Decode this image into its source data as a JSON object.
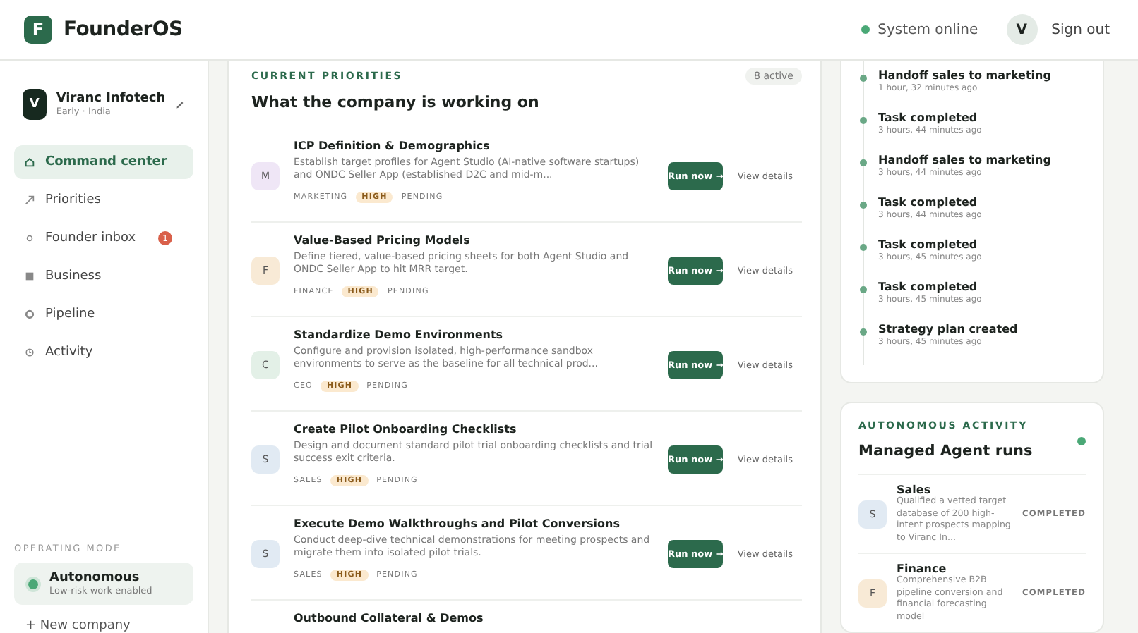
{
  "header": {
    "logo_letter": "F",
    "app_name": "FounderOS",
    "status": "System online",
    "avatar_letter": "V",
    "sign_out": "Sign out"
  },
  "sidebar": {
    "company": {
      "letter": "V",
      "name": "Viranc Infotech",
      "meta": "Early · India"
    },
    "items": [
      {
        "label": "Command center",
        "selected": true
      },
      {
        "label": "Priorities",
        "selected": false
      },
      {
        "label": "Founder inbox",
        "selected": false,
        "badge": "1"
      },
      {
        "label": "Business",
        "selected": false
      },
      {
        "label": "Pipeline",
        "selected": false
      },
      {
        "label": "Activity",
        "selected": false
      }
    ],
    "mode_heading": "OPERATING MODE",
    "mode": {
      "title": "Autonomous",
      "subtitle": "Low-risk work enabled"
    },
    "new_company": "+ New company"
  },
  "priorities": {
    "eyebrow": "CURRENT PRIORITIES",
    "title": "What the company is working on",
    "count": "8 active",
    "items": [
      {
        "letter": "M",
        "color": "#efe6f6",
        "title": "ICP Definition & Demographics",
        "description": "Establish target profiles for Agent Studio (AI-native software startups) and ONDC Seller App (established D2C and mid-m...",
        "team": "MARKETING",
        "priority": "HIGH",
        "status": "PENDING",
        "run": "Run now →",
        "details": "View details"
      },
      {
        "letter": "F",
        "color": "#f8ead6",
        "title": "Value-Based Pricing Models",
        "description": "Define tiered, value-based pricing sheets for both Agent Studio and ONDC Seller App to hit MRR target.",
        "team": "FINANCE",
        "priority": "HIGH",
        "status": "PENDING",
        "run": "Run now →",
        "details": "View details"
      },
      {
        "letter": "C",
        "color": "#e3f0e7",
        "title": "Standardize Demo Environments",
        "description": "Configure and provision isolated, high-performance sandbox environments to serve as the baseline for all technical prod...",
        "team": "CEO",
        "priority": "HIGH",
        "status": "PENDING",
        "run": "Run now →",
        "details": "View details"
      },
      {
        "letter": "S",
        "color": "#e1eaf3",
        "title": "Create Pilot Onboarding Checklists",
        "description": "Design and document standard pilot trial onboarding checklists and trial success exit criteria.",
        "team": "SALES",
        "priority": "HIGH",
        "status": "PENDING",
        "run": "Run now →",
        "details": "View details"
      },
      {
        "letter": "S",
        "color": "#e1eaf3",
        "title": "Execute Demo Walkthroughs and Pilot Conversions",
        "description": "Conduct deep-dive technical demonstrations for meeting prospects and migrate them into isolated pilot trials.",
        "team": "SALES",
        "priority": "HIGH",
        "status": "PENDING",
        "run": "Run now →",
        "details": "View details"
      },
      {
        "title": "Outbound Collateral & Demos"
      }
    ]
  },
  "timeline": [
    {
      "title": "Handoff sales to marketing",
      "time": "1 hour, 32 minutes ago"
    },
    {
      "title": "Task completed",
      "time": "3 hours, 44 minutes ago"
    },
    {
      "title": "Handoff sales to marketing",
      "time": "3 hours, 44 minutes ago"
    },
    {
      "title": "Task completed",
      "time": "3 hours, 44 minutes ago"
    },
    {
      "title": "Task completed",
      "time": "3 hours, 45 minutes ago"
    },
    {
      "title": "Task completed",
      "time": "3 hours, 45 minutes ago"
    },
    {
      "title": "Strategy plan created",
      "time": "3 hours, 45 minutes ago"
    }
  ],
  "agent_runs": {
    "eyebrow": "AUTONOMOUS ACTIVITY",
    "title": "Managed Agent runs",
    "items": [
      {
        "letter": "S",
        "color": "#e1eaf3",
        "name": "Sales",
        "description": "Qualified a vetted target database of 200 high-intent prospects mapping to Viranc In...",
        "status": "COMPLETED"
      },
      {
        "letter": "F",
        "color": "#f8ead6",
        "name": "Finance",
        "description": "Comprehensive B2B pipeline conversion and financial forecasting model",
        "status": "COMPLETED"
      }
    ]
  }
}
